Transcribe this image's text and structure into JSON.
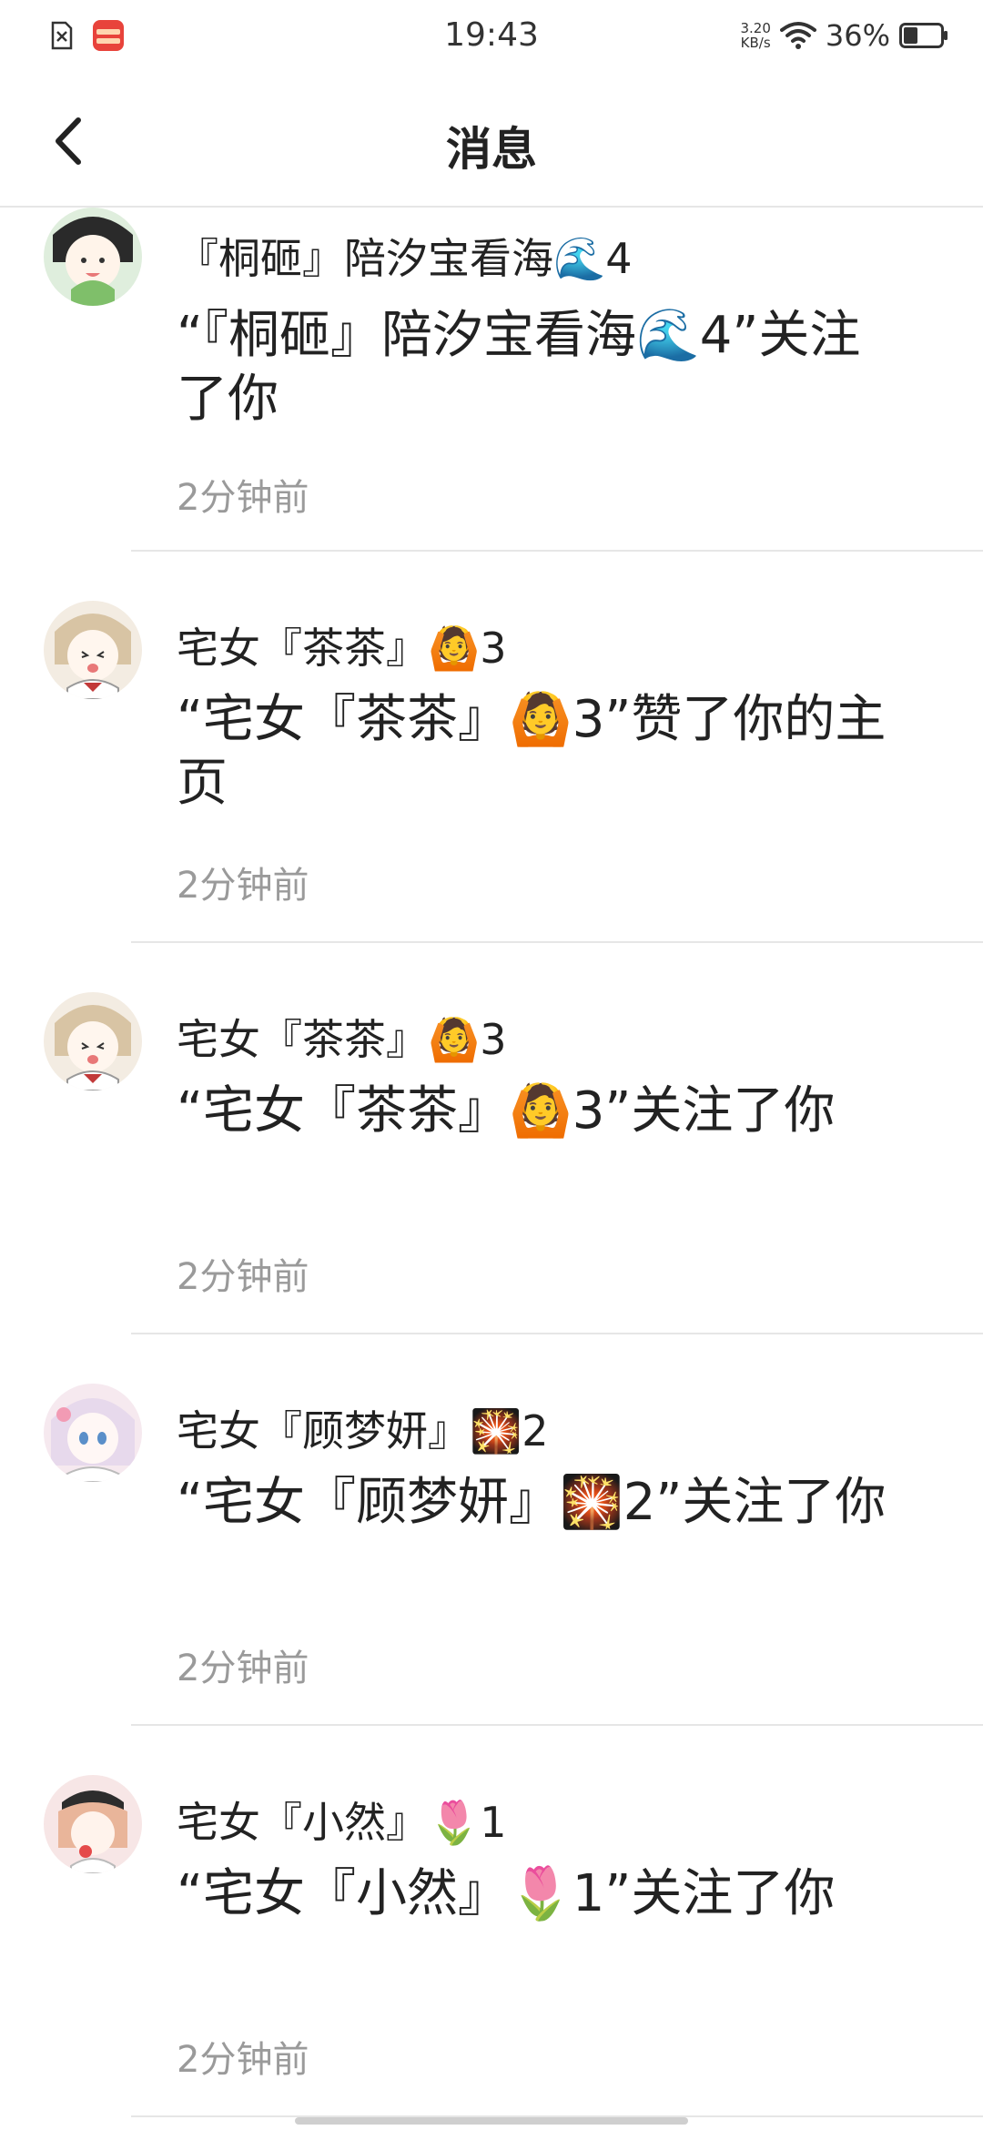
{
  "status_bar": {
    "time": "19:43",
    "net_speed_value": "3.20",
    "net_speed_unit": "KB/s",
    "battery": "36%"
  },
  "header": {
    "title": "消息"
  },
  "messages": [
    {
      "name": "『桐砸』陪汐宝看海🌊4",
      "text": "“『桐砸』陪汐宝看海🌊4”关注了你",
      "time": "2分钟前"
    },
    {
      "name": "宅女『茶茶』🙆3",
      "text": "“宅女『茶茶』🙆3”赞了你的主页",
      "time": "2分钟前"
    },
    {
      "name": "宅女『茶茶』🙆3",
      "text": "“宅女『茶茶』🙆3”关注了你",
      "time": "2分钟前"
    },
    {
      "name": "宅女『顾梦妍』🎇2",
      "text": "“宅女『顾梦妍』🎇2”关注了你",
      "time": "2分钟前"
    },
    {
      "name": "宅女『小然』🌷1",
      "text": "“宅女『小然』🌷1”关注了你",
      "time": "2分钟前"
    }
  ]
}
